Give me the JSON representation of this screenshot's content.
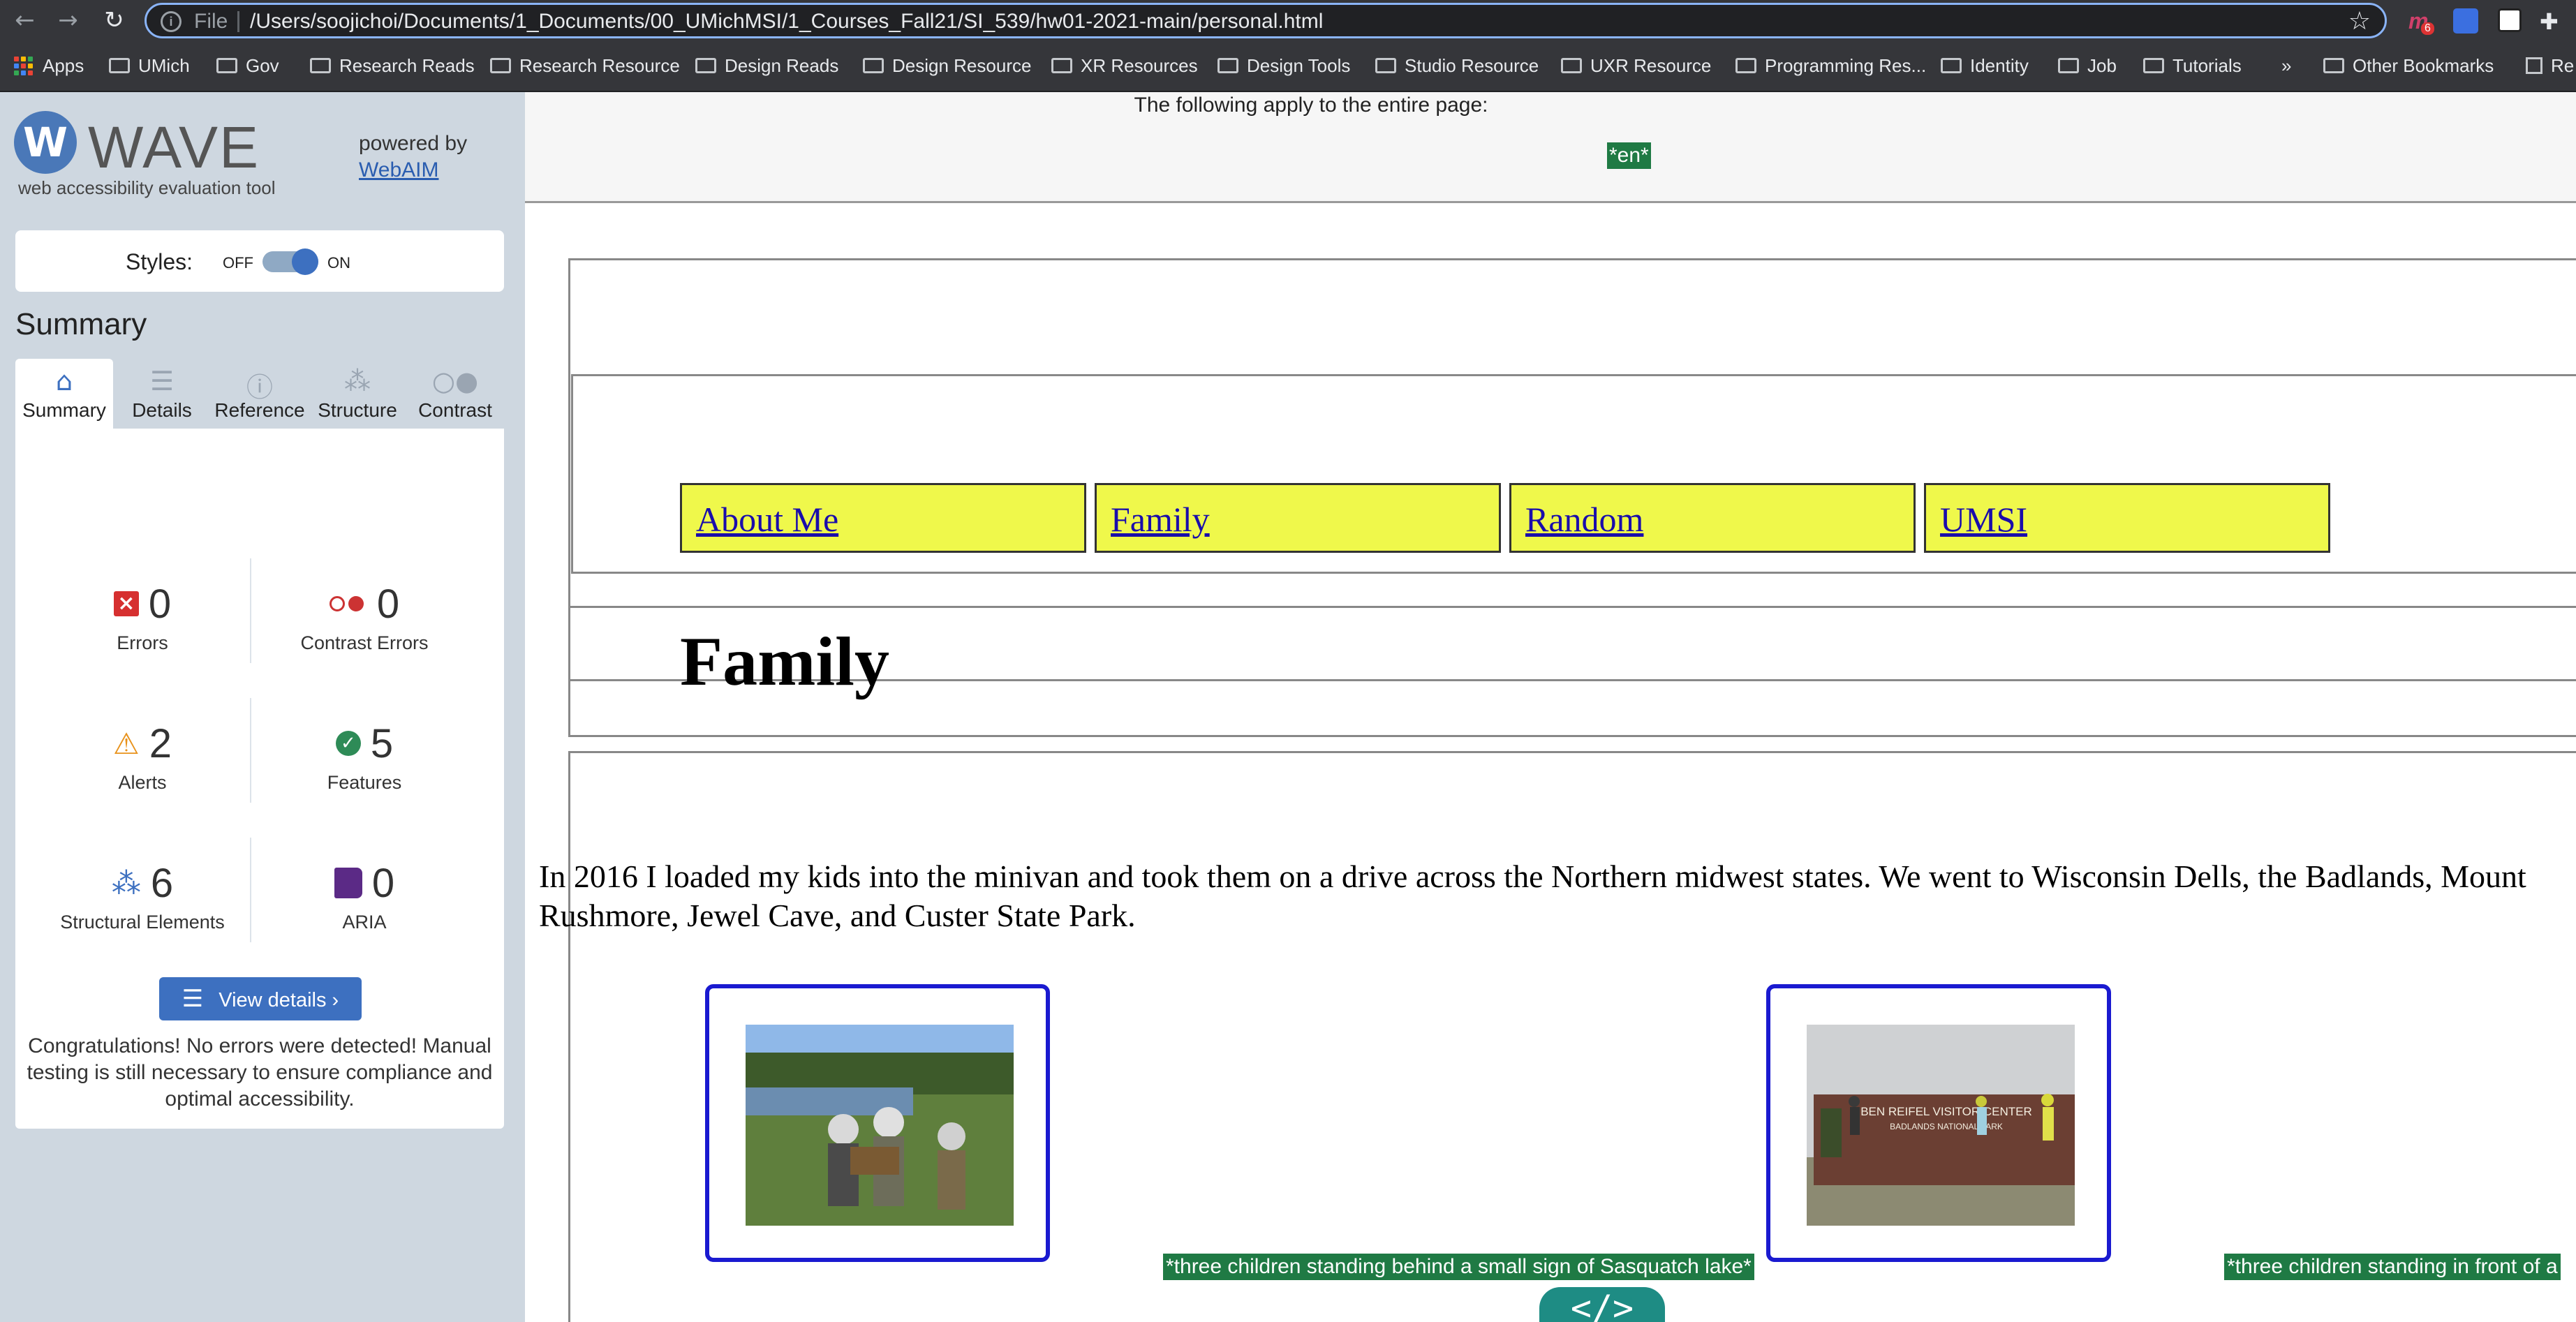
{
  "browser": {
    "url_scheme": "File",
    "url": "/Users/soojichoi/Documents/1_Documents/00_UMichMSI/1_Courses_Fall21/SI_539/hw01-2021-main/personal.html",
    "extension_badge": "6",
    "bookmarks": [
      "Apps",
      "UMich",
      "Gov",
      "Research Reads",
      "Research Resource",
      "Design Reads",
      "Design Resource",
      "XR Resources",
      "Design Tools",
      "Studio Resource",
      "UXR Resource",
      "Programming Res...",
      "Identity",
      "Job",
      "Tutorials"
    ],
    "more_bookmarks": "»",
    "other_bookmarks": "Other Bookmarks",
    "reading_list": "Re"
  },
  "wave": {
    "title": "WAVE",
    "subtitle": "web accessibility evaluation tool",
    "powered_by": "powered by",
    "webaim": "WebAIM",
    "styles_label": "Styles:",
    "styles_off": "OFF",
    "styles_on": "ON",
    "summary_heading": "Summary",
    "tabs": [
      "Summary",
      "Details",
      "Reference",
      "Structure",
      "Contrast"
    ],
    "stats": {
      "errors": {
        "count": "0",
        "label": "Errors"
      },
      "contrast_errors": {
        "count": "0",
        "label": "Contrast Errors"
      },
      "alerts": {
        "count": "2",
        "label": "Alerts"
      },
      "features": {
        "count": "5",
        "label": "Features"
      },
      "structural": {
        "count": "6",
        "label": "Structural Elements"
      },
      "aria": {
        "count": "0",
        "label": "ARIA"
      }
    },
    "view_details": "View details ›",
    "congrats": "Congratulations! No errors were detected! Manual testing is still necessary to ensure compliance and optimal accessibility."
  },
  "page": {
    "applies_text": "The following apply to the entire page:",
    "lang_tag": "*en*",
    "nav": [
      "About Me",
      "Family",
      "Random",
      "UMSI"
    ],
    "heading": "Family",
    "paragraph": "In 2016 I loaded my kids into the minivan and took them on a drive across the Northern midwest states. We went to Wisconsin Dells, the Badlands, Mount Rushmore, Jewel Cave, and Custer State Park.",
    "alt1": "*three children standing behind a small sign of Sasquatch lake*",
    "alt2": "*three children standing in front of a",
    "sign_text_1": "BEN REIFEL VISITOR CENTER",
    "sign_text_2": "BADLANDS NATIONAL PARK",
    "code_toggle": "</>"
  },
  "colors": {
    "chrome_bg": "#35363a",
    "wave_sidebar": "#ced7e0",
    "wave_accent": "#3d70c0",
    "nav_bg": "#eff84b",
    "alt_tag_bg": "#1f7a44",
    "image_border": "#1a1ad0"
  }
}
